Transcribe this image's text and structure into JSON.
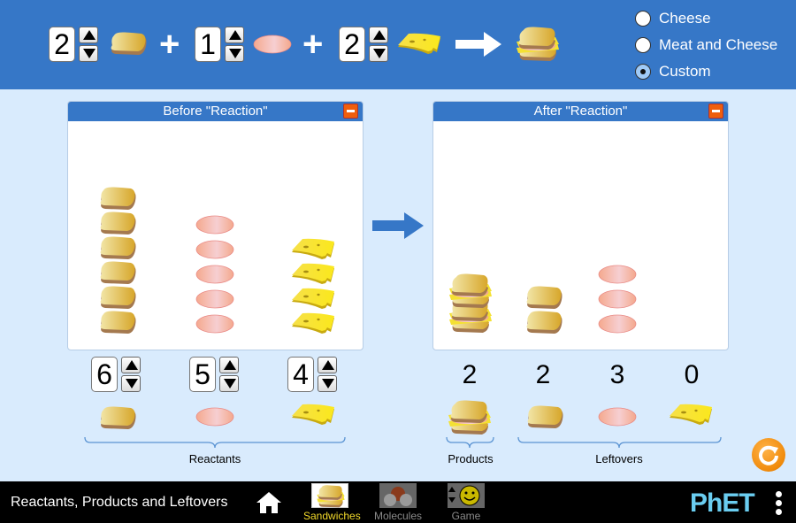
{
  "equation": {
    "reactants": [
      {
        "name": "bread",
        "coefficient": "2"
      },
      {
        "name": "meat",
        "coefficient": "1"
      },
      {
        "name": "cheese",
        "coefficient": "2"
      }
    ],
    "product": "sandwich",
    "plus_symbol": "+"
  },
  "sandwich_options": {
    "items": [
      {
        "label": "Cheese",
        "selected": false
      },
      {
        "label": "Meat and Cheese",
        "selected": false
      },
      {
        "label": "Custom",
        "selected": true
      }
    ]
  },
  "before_panel": {
    "title": "Before \"Reaction\"",
    "contents": {
      "bread": 6,
      "meat": 5,
      "cheese": 4
    }
  },
  "after_panel": {
    "title": "After \"Reaction\"",
    "contents": {
      "sandwich": 2,
      "bread": 2,
      "meat": 3,
      "cheese": 0
    }
  },
  "reactants": {
    "label": "Reactants",
    "items": [
      {
        "name": "bread",
        "quantity": "6"
      },
      {
        "name": "meat",
        "quantity": "5"
      },
      {
        "name": "cheese",
        "quantity": "4"
      }
    ]
  },
  "products": {
    "label": "Products",
    "items": [
      {
        "name": "sandwich",
        "quantity": "2"
      }
    ]
  },
  "leftovers": {
    "label": "Leftovers",
    "items": [
      {
        "name": "bread",
        "quantity": "2"
      },
      {
        "name": "meat",
        "quantity": "3"
      },
      {
        "name": "cheese",
        "quantity": "0"
      }
    ]
  },
  "navbar": {
    "sim_title": "Reactants, Products and Leftovers",
    "screens": [
      {
        "label": "Sandwiches",
        "icon": "sandwich-icon",
        "active": true
      },
      {
        "label": "Molecules",
        "icon": "molecule-icon",
        "active": false
      },
      {
        "label": "Game",
        "icon": "game-smiley-icon",
        "active": false
      }
    ],
    "logo": "PhET"
  },
  "colors": {
    "primary_blue": "#3677c7",
    "background": "#d9ebfd",
    "reset_orange": "#f08a0b",
    "minimize_orange": "#ef5e0c",
    "active_nav": "#f2d92b",
    "logo_blue": "#6acdf0"
  }
}
